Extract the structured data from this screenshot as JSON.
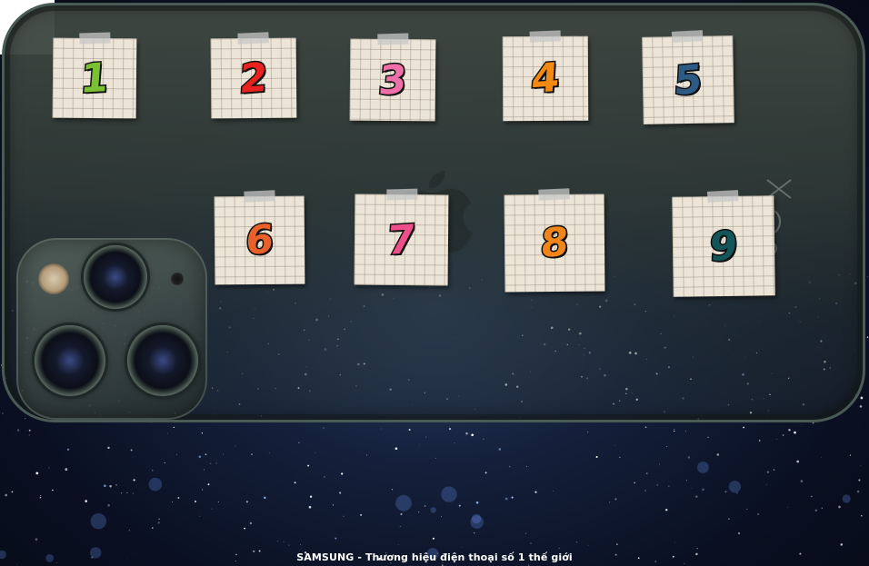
{
  "footer": {
    "text": "SAMSUNG - Thương hiệu điện thoại số 1 thế giới"
  },
  "notes": [
    {
      "label": "1",
      "color": "#7ac231"
    },
    {
      "label": "2",
      "color": "#e8221f"
    },
    {
      "label": "3",
      "color": "#ef6fa8"
    },
    {
      "label": "4",
      "color": "#f28a12"
    },
    {
      "label": "5",
      "color": "#2e5a86"
    },
    {
      "label": "6",
      "color": "#e8602a"
    },
    {
      "label": "7",
      "color": "#ee4f8a"
    },
    {
      "label": "8",
      "color": "#f0861a"
    },
    {
      "label": "9",
      "color": "#14555a"
    }
  ],
  "icons": {
    "apple_logo": "apple-logo-icon",
    "camera": "camera-module"
  }
}
